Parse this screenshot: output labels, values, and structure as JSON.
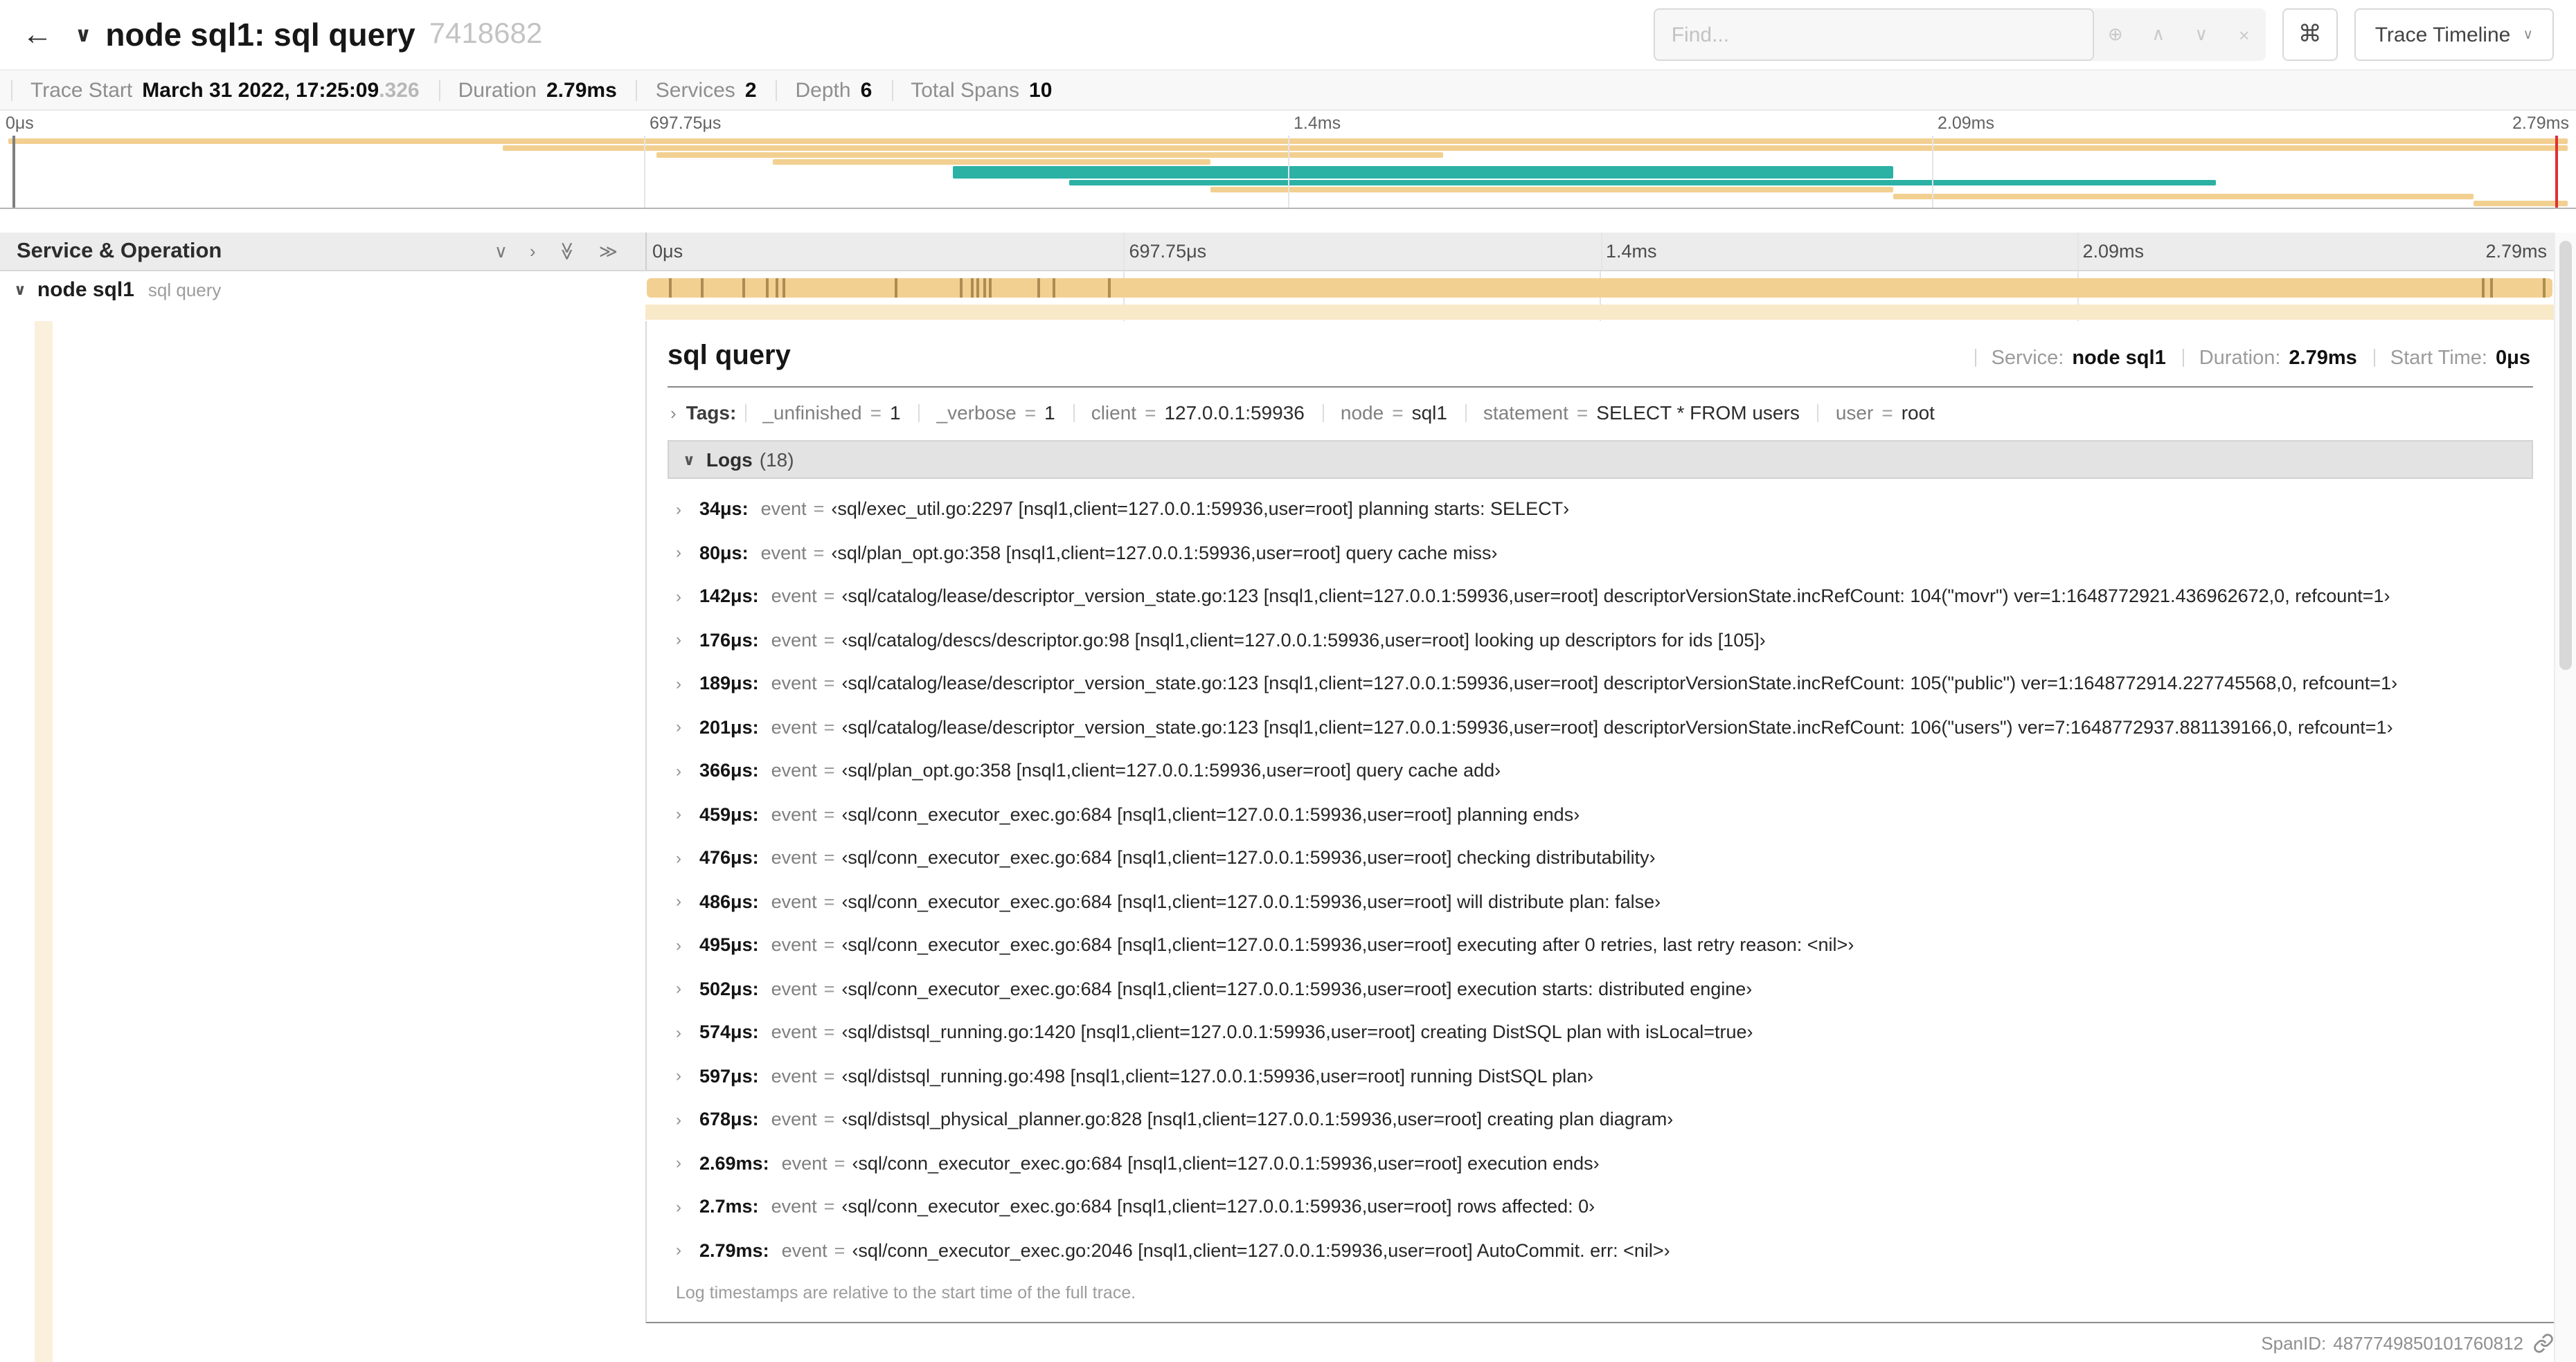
{
  "colors": {
    "tan": "#F2D091",
    "tan_pale": "#F8E9C9",
    "tan_band": "#FAF0DC",
    "teal": "#2CB1A5",
    "tick": "rgba(88,58,12,0.45)",
    "red_line": "#E03131"
  },
  "glyphs": {
    "back": "←",
    "title_chevron": "∨",
    "find_plus": "⊕",
    "find_prev": "∧",
    "find_next": "∨",
    "find_clear": "×",
    "command": "⌘",
    "view_chevron": "∨",
    "collapse_one": "∨",
    "expand_one": "›",
    "collapse_all": "≫",
    "expand_all": "≫",
    "row_chevron": "∨",
    "tags_chevron": "›",
    "logs_chevron": "∨",
    "log_chevron": "›"
  },
  "header": {
    "title": "node sql1: sql query",
    "trace_id": "7418682",
    "find_placeholder": "Find...",
    "view_button": "Trace Timeline"
  },
  "summary": {
    "items": [
      {
        "label": "Trace Start",
        "value": "March 31 2022, 17:25:09",
        "suffix": ".326"
      },
      {
        "label": "Duration",
        "value": "2.79ms"
      },
      {
        "label": "Services",
        "value": "2"
      },
      {
        "label": "Depth",
        "value": "6"
      },
      {
        "label": "Total Spans",
        "value": "10"
      }
    ]
  },
  "time_ticks": [
    {
      "label": "0μs",
      "pct": 0
    },
    {
      "label": "697.75μs",
      "pct": 25
    },
    {
      "label": "1.4ms",
      "pct": 50
    },
    {
      "label": "2.09ms",
      "pct": 75
    },
    {
      "label": "2.79ms",
      "pct": 100
    }
  ],
  "grid_pcts": [
    25,
    50,
    75,
    100
  ],
  "minimap": {
    "spans": [
      {
        "row": 0,
        "start": 0.3,
        "end": 99.7,
        "color": "tan"
      },
      {
        "row": 1,
        "start": 19.5,
        "end": 99.7,
        "color": "tan"
      },
      {
        "row": 2,
        "start": 25.5,
        "end": 56,
        "color": "tan"
      },
      {
        "row": 3,
        "start": 30,
        "end": 47,
        "color": "tan"
      },
      {
        "row": 4,
        "start": 37,
        "end": 73.5,
        "color": "teal",
        "thick": true
      },
      {
        "row": 6,
        "start": 41.5,
        "end": 86,
        "color": "teal"
      },
      {
        "row": 7,
        "start": 47,
        "end": 73.5,
        "color": "tan"
      },
      {
        "row": 8,
        "start": 73.5,
        "end": 96,
        "color": "tan"
      },
      {
        "row": 9,
        "start": 96,
        "end": 99.7,
        "color": "tan"
      }
    ]
  },
  "timeline": {
    "left_header": "Service & Operation"
  },
  "span_row": {
    "service": "node sql1",
    "operation": "sql query",
    "log_tick_pcts": [
      1.2,
      2.9,
      5.1,
      6.3,
      6.8,
      7.2,
      13.1,
      16.5,
      17.1,
      17.4,
      17.7,
      18,
      20.6,
      21.4,
      24.3,
      96.4,
      96.8,
      99.6
    ]
  },
  "detail": {
    "title": "sql query",
    "meta": [
      {
        "label": "Service:",
        "value": "node sql1"
      },
      {
        "label": "Duration:",
        "value": "2.79ms"
      },
      {
        "label": "Start Time:",
        "value": "0μs"
      }
    ],
    "tags_label": "Tags:",
    "eq": "=",
    "tags": [
      {
        "key": "_unfinished",
        "value": "1"
      },
      {
        "key": "_verbose",
        "value": "1"
      },
      {
        "key": "client",
        "value": "127.0.0.1:59936"
      },
      {
        "key": "node",
        "value": "sql1"
      },
      {
        "key": "statement",
        "value": "SELECT * FROM users"
      },
      {
        "key": "user",
        "value": "root"
      }
    ],
    "logs_title": "Logs",
    "logs_count": "(18)",
    "log_field": "event",
    "logs": [
      {
        "time": "34μs:",
        "value": "‹sql/exec_util.go:2297 [nsql1,client=127.0.0.1:59936,user=root] planning starts: SELECT›"
      },
      {
        "time": "80μs:",
        "value": "‹sql/plan_opt.go:358 [nsql1,client=127.0.0.1:59936,user=root] query cache miss›"
      },
      {
        "time": "142μs:",
        "value": "‹sql/catalog/lease/descriptor_version_state.go:123 [nsql1,client=127.0.0.1:59936,user=root] descriptorVersionState.incRefCount: 104(\"movr\") ver=1:1648772921.436962672,0, refcount=1›"
      },
      {
        "time": "176μs:",
        "value": "‹sql/catalog/descs/descriptor.go:98 [nsql1,client=127.0.0.1:59936,user=root] looking up descriptors for ids [105]›"
      },
      {
        "time": "189μs:",
        "value": "‹sql/catalog/lease/descriptor_version_state.go:123 [nsql1,client=127.0.0.1:59936,user=root] descriptorVersionState.incRefCount: 105(\"public\") ver=1:1648772914.227745568,0, refcount=1›"
      },
      {
        "time": "201μs:",
        "value": "‹sql/catalog/lease/descriptor_version_state.go:123 [nsql1,client=127.0.0.1:59936,user=root] descriptorVersionState.incRefCount: 106(\"users\") ver=7:1648772937.881139166,0, refcount=1›"
      },
      {
        "time": "366μs:",
        "value": "‹sql/plan_opt.go:358 [nsql1,client=127.0.0.1:59936,user=root] query cache add›"
      },
      {
        "time": "459μs:",
        "value": "‹sql/conn_executor_exec.go:684 [nsql1,client=127.0.0.1:59936,user=root] planning ends›"
      },
      {
        "time": "476μs:",
        "value": "‹sql/conn_executor_exec.go:684 [nsql1,client=127.0.0.1:59936,user=root] checking distributability›"
      },
      {
        "time": "486μs:",
        "value": "‹sql/conn_executor_exec.go:684 [nsql1,client=127.0.0.1:59936,user=root] will distribute plan: false›"
      },
      {
        "time": "495μs:",
        "value": "‹sql/conn_executor_exec.go:684 [nsql1,client=127.0.0.1:59936,user=root] executing after 0 retries, last retry reason: <nil>›"
      },
      {
        "time": "502μs:",
        "value": "‹sql/conn_executor_exec.go:684 [nsql1,client=127.0.0.1:59936,user=root] execution starts: distributed engine›"
      },
      {
        "time": "574μs:",
        "value": "‹sql/distsql_running.go:1420 [nsql1,client=127.0.0.1:59936,user=root] creating DistSQL plan with isLocal=true›"
      },
      {
        "time": "597μs:",
        "value": "‹sql/distsql_running.go:498 [nsql1,client=127.0.0.1:59936,user=root] running DistSQL plan›"
      },
      {
        "time": "678μs:",
        "value": "‹sql/distsql_physical_planner.go:828 [nsql1,client=127.0.0.1:59936,user=root] creating plan diagram›"
      },
      {
        "time": "2.69ms:",
        "value": "‹sql/conn_executor_exec.go:684 [nsql1,client=127.0.0.1:59936,user=root] execution ends›"
      },
      {
        "time": "2.7ms:",
        "value": "‹sql/conn_executor_exec.go:684 [nsql1,client=127.0.0.1:59936,user=root] rows affected: 0›"
      },
      {
        "time": "2.79ms:",
        "value": "‹sql/conn_executor_exec.go:2046 [nsql1,client=127.0.0.1:59936,user=root] AutoCommit. err: <nil>›"
      }
    ],
    "footnote": "Log timestamps are relative to the start time of the full trace.",
    "span_id_label": "SpanID:",
    "span_id": "4877749850101760812"
  }
}
